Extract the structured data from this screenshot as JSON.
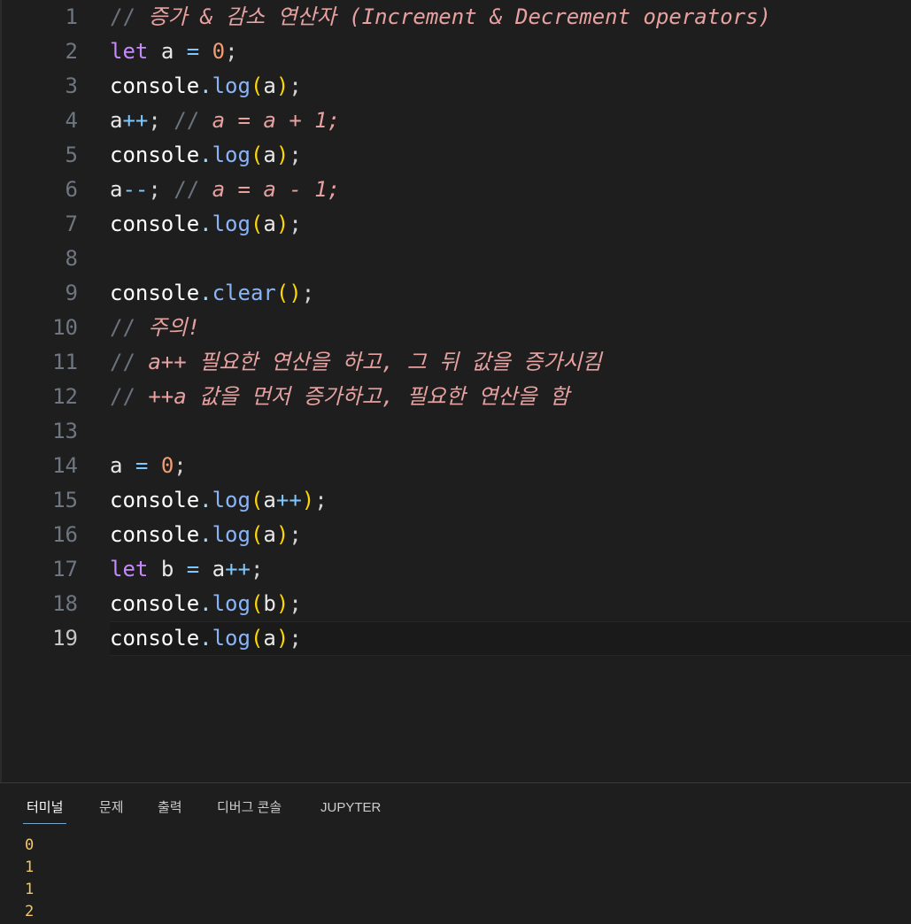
{
  "editor": {
    "lines": [
      {
        "n": "1",
        "tokens": [
          {
            "t": "// ",
            "c": "t-cslash"
          },
          {
            "t": "증가 & 감소 연산자 (Increment & Decrement operators)",
            "c": "t-comment"
          }
        ]
      },
      {
        "n": "2",
        "tokens": [
          {
            "t": "let",
            "c": "t-keyword"
          },
          {
            "t": " ",
            "c": "t-punct"
          },
          {
            "t": "a",
            "c": "t-var"
          },
          {
            "t": " = ",
            "c": "t-op"
          },
          {
            "t": "0",
            "c": "t-num"
          },
          {
            "t": ";",
            "c": "t-punct"
          }
        ]
      },
      {
        "n": "3",
        "tokens": [
          {
            "t": "console",
            "c": "t-obj"
          },
          {
            "t": ".",
            "c": "t-dot"
          },
          {
            "t": "log",
            "c": "t-func"
          },
          {
            "t": "(",
            "c": "t-paren"
          },
          {
            "t": "a",
            "c": "t-var"
          },
          {
            "t": ")",
            "c": "t-paren"
          },
          {
            "t": ";",
            "c": "t-punct"
          }
        ]
      },
      {
        "n": "4",
        "tokens": [
          {
            "t": "a",
            "c": "t-var"
          },
          {
            "t": "++",
            "c": "t-op"
          },
          {
            "t": "; ",
            "c": "t-punct"
          },
          {
            "t": "// ",
            "c": "t-cslash"
          },
          {
            "t": "a = a + 1;",
            "c": "t-comment"
          }
        ]
      },
      {
        "n": "5",
        "tokens": [
          {
            "t": "console",
            "c": "t-obj"
          },
          {
            "t": ".",
            "c": "t-dot"
          },
          {
            "t": "log",
            "c": "t-func"
          },
          {
            "t": "(",
            "c": "t-paren"
          },
          {
            "t": "a",
            "c": "t-var"
          },
          {
            "t": ")",
            "c": "t-paren"
          },
          {
            "t": ";",
            "c": "t-punct"
          }
        ]
      },
      {
        "n": "6",
        "tokens": [
          {
            "t": "a",
            "c": "t-var"
          },
          {
            "t": "--",
            "c": "t-op"
          },
          {
            "t": "; ",
            "c": "t-punct"
          },
          {
            "t": "// ",
            "c": "t-cslash"
          },
          {
            "t": "a = a - 1;",
            "c": "t-comment"
          }
        ]
      },
      {
        "n": "7",
        "tokens": [
          {
            "t": "console",
            "c": "t-obj"
          },
          {
            "t": ".",
            "c": "t-dot"
          },
          {
            "t": "log",
            "c": "t-func"
          },
          {
            "t": "(",
            "c": "t-paren"
          },
          {
            "t": "a",
            "c": "t-var"
          },
          {
            "t": ")",
            "c": "t-paren"
          },
          {
            "t": ";",
            "c": "t-punct"
          }
        ]
      },
      {
        "n": "8",
        "tokens": []
      },
      {
        "n": "9",
        "tokens": [
          {
            "t": "console",
            "c": "t-obj"
          },
          {
            "t": ".",
            "c": "t-dot"
          },
          {
            "t": "clear",
            "c": "t-func"
          },
          {
            "t": "()",
            "c": "t-paren"
          },
          {
            "t": ";",
            "c": "t-punct"
          }
        ]
      },
      {
        "n": "10",
        "tokens": [
          {
            "t": "// ",
            "c": "t-cslash"
          },
          {
            "t": "주의!",
            "c": "t-comment"
          }
        ]
      },
      {
        "n": "11",
        "tokens": [
          {
            "t": "// ",
            "c": "t-cslash"
          },
          {
            "t": "a++ 필요한 연산을 하고, 그 뒤 값을 증가시킴",
            "c": "t-comment"
          }
        ]
      },
      {
        "n": "12",
        "tokens": [
          {
            "t": "// ",
            "c": "t-cslash"
          },
          {
            "t": "++a 값을 먼저 증가하고, 필요한 연산을 함",
            "c": "t-comment"
          }
        ]
      },
      {
        "n": "13",
        "tokens": []
      },
      {
        "n": "14",
        "tokens": [
          {
            "t": "a",
            "c": "t-var"
          },
          {
            "t": " = ",
            "c": "t-op"
          },
          {
            "t": "0",
            "c": "t-num"
          },
          {
            "t": ";",
            "c": "t-punct"
          }
        ]
      },
      {
        "n": "15",
        "tokens": [
          {
            "t": "console",
            "c": "t-obj"
          },
          {
            "t": ".",
            "c": "t-dot"
          },
          {
            "t": "log",
            "c": "t-func"
          },
          {
            "t": "(",
            "c": "t-paren"
          },
          {
            "t": "a",
            "c": "t-var"
          },
          {
            "t": "++",
            "c": "t-op"
          },
          {
            "t": ")",
            "c": "t-paren"
          },
          {
            "t": ";",
            "c": "t-punct"
          }
        ]
      },
      {
        "n": "16",
        "tokens": [
          {
            "t": "console",
            "c": "t-obj"
          },
          {
            "t": ".",
            "c": "t-dot"
          },
          {
            "t": "log",
            "c": "t-func"
          },
          {
            "t": "(",
            "c": "t-paren"
          },
          {
            "t": "a",
            "c": "t-var"
          },
          {
            "t": ")",
            "c": "t-paren"
          },
          {
            "t": ";",
            "c": "t-punct"
          }
        ]
      },
      {
        "n": "17",
        "tokens": [
          {
            "t": "let",
            "c": "t-keyword"
          },
          {
            "t": " ",
            "c": "t-punct"
          },
          {
            "t": "b",
            "c": "t-var"
          },
          {
            "t": " = ",
            "c": "t-op"
          },
          {
            "t": "a",
            "c": "t-var"
          },
          {
            "t": "++",
            "c": "t-op"
          },
          {
            "t": ";",
            "c": "t-punct"
          }
        ]
      },
      {
        "n": "18",
        "tokens": [
          {
            "t": "console",
            "c": "t-obj"
          },
          {
            "t": ".",
            "c": "t-dot"
          },
          {
            "t": "log",
            "c": "t-func"
          },
          {
            "t": "(",
            "c": "t-paren"
          },
          {
            "t": "b",
            "c": "t-var"
          },
          {
            "t": ")",
            "c": "t-paren"
          },
          {
            "t": ";",
            "c": "t-punct"
          }
        ]
      },
      {
        "n": "19",
        "current": true,
        "tokens": [
          {
            "t": "console",
            "c": "t-obj"
          },
          {
            "t": ".",
            "c": "t-dot"
          },
          {
            "t": "log",
            "c": "t-func"
          },
          {
            "t": "(",
            "c": "t-paren"
          },
          {
            "t": "a",
            "c": "t-var"
          },
          {
            "t": ")",
            "c": "t-paren"
          },
          {
            "t": ";",
            "c": "t-punct"
          }
        ]
      }
    ]
  },
  "panel": {
    "tabs": [
      {
        "label": "터미널",
        "active": true
      },
      {
        "label": "문제",
        "active": false
      },
      {
        "label": "출력",
        "active": false
      },
      {
        "label": "디버그 콘솔",
        "active": false
      },
      {
        "label": "JUPYTER",
        "active": false
      }
    ],
    "output": [
      "0",
      "1",
      "1",
      "2"
    ]
  },
  "colors": {
    "background": "#1e1e1e",
    "comment": "#e6a1a0",
    "keyword": "#c58af9",
    "function": "#8ab4f8",
    "number": "#f29c72",
    "paren": "#ffd700",
    "output": "#f2c867"
  }
}
